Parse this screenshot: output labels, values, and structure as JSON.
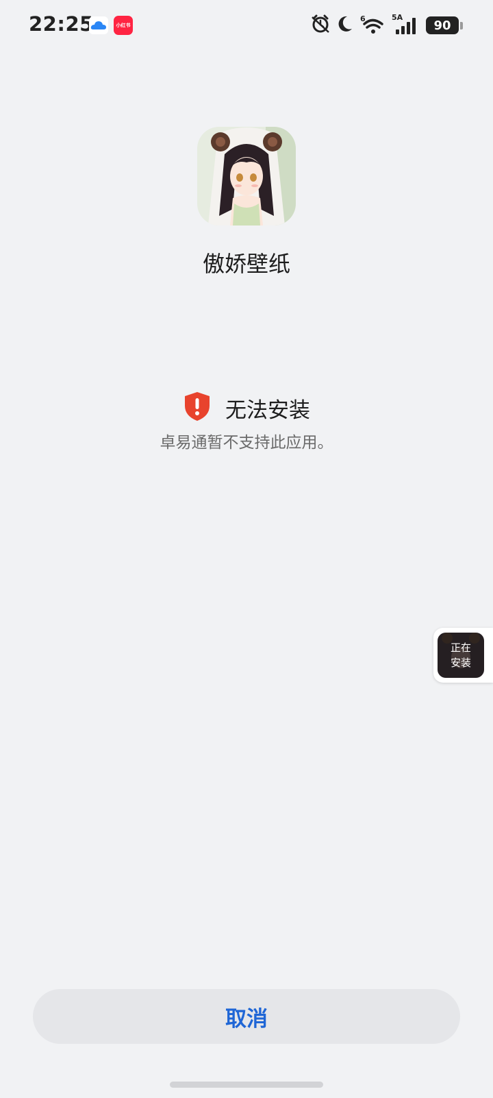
{
  "status_bar": {
    "time": "22:25",
    "notifications": {
      "cloud_icon": "cloud-icon",
      "xhs_label": "小红书"
    },
    "icons": [
      "alarm-icon",
      "moon-icon",
      "wifi-icon",
      "signal-icon"
    ],
    "wifi_label": "6",
    "network_label": "5A",
    "battery_level": "90"
  },
  "app": {
    "name": "傲娇壁纸"
  },
  "install": {
    "status_title": "无法安装",
    "status_desc": "卓易通暂不支持此应用。",
    "status_color": "#e8432d"
  },
  "floating_bubble": {
    "line1": "正在",
    "line2": "安装"
  },
  "actions": {
    "cancel_label": "取消",
    "accent": "#1f66d6"
  }
}
